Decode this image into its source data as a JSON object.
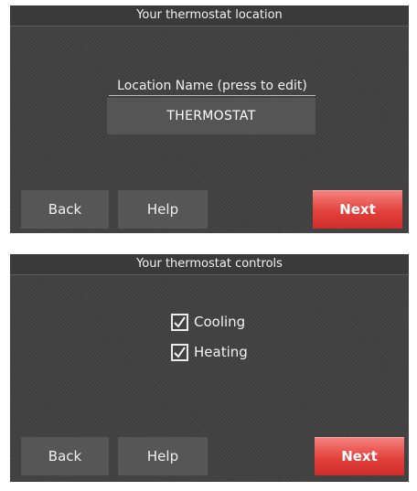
{
  "screens": [
    {
      "title": "Your thermostat location",
      "location_label": "Location Name (press to edit)",
      "location_value": "THERMOSTAT",
      "buttons": {
        "back": "Back",
        "help": "Help",
        "next": "Next"
      }
    },
    {
      "title": "Your thermostat controls",
      "controls": [
        {
          "label": "Cooling",
          "checked": true,
          "icon": "checkmark-icon"
        },
        {
          "label": "Heating",
          "checked": true,
          "icon": "checkmark-icon"
        }
      ],
      "buttons": {
        "back": "Back",
        "help": "Help",
        "next": "Next"
      }
    }
  ],
  "colors": {
    "screen_background": "#414141",
    "button_background": "#565656",
    "next_button_accent": "#e3413d",
    "text": "#f2f2f2"
  }
}
